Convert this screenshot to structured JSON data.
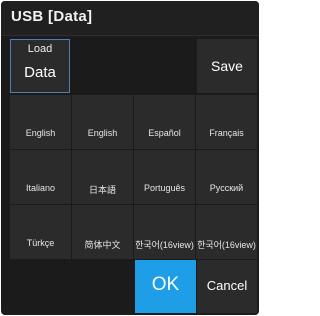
{
  "dialog": {
    "title": "USB [Data]"
  },
  "actions": {
    "load_line1": "Load",
    "load_line2": "Data",
    "save": "Save",
    "ok": "OK",
    "cancel": "Cancel"
  },
  "languages": [
    "English",
    "English",
    "Español",
    "Français",
    "Italiano",
    "日本語",
    "Português",
    "Русский",
    "Türkçe",
    "简体中文",
    "한국어(16view)",
    "한국어(16view)"
  ],
  "colors": {
    "background": "#1b1b1b",
    "button": "#2b2b2b",
    "accent": "#1e9ee6",
    "selected_border": "#4d7fb0"
  }
}
